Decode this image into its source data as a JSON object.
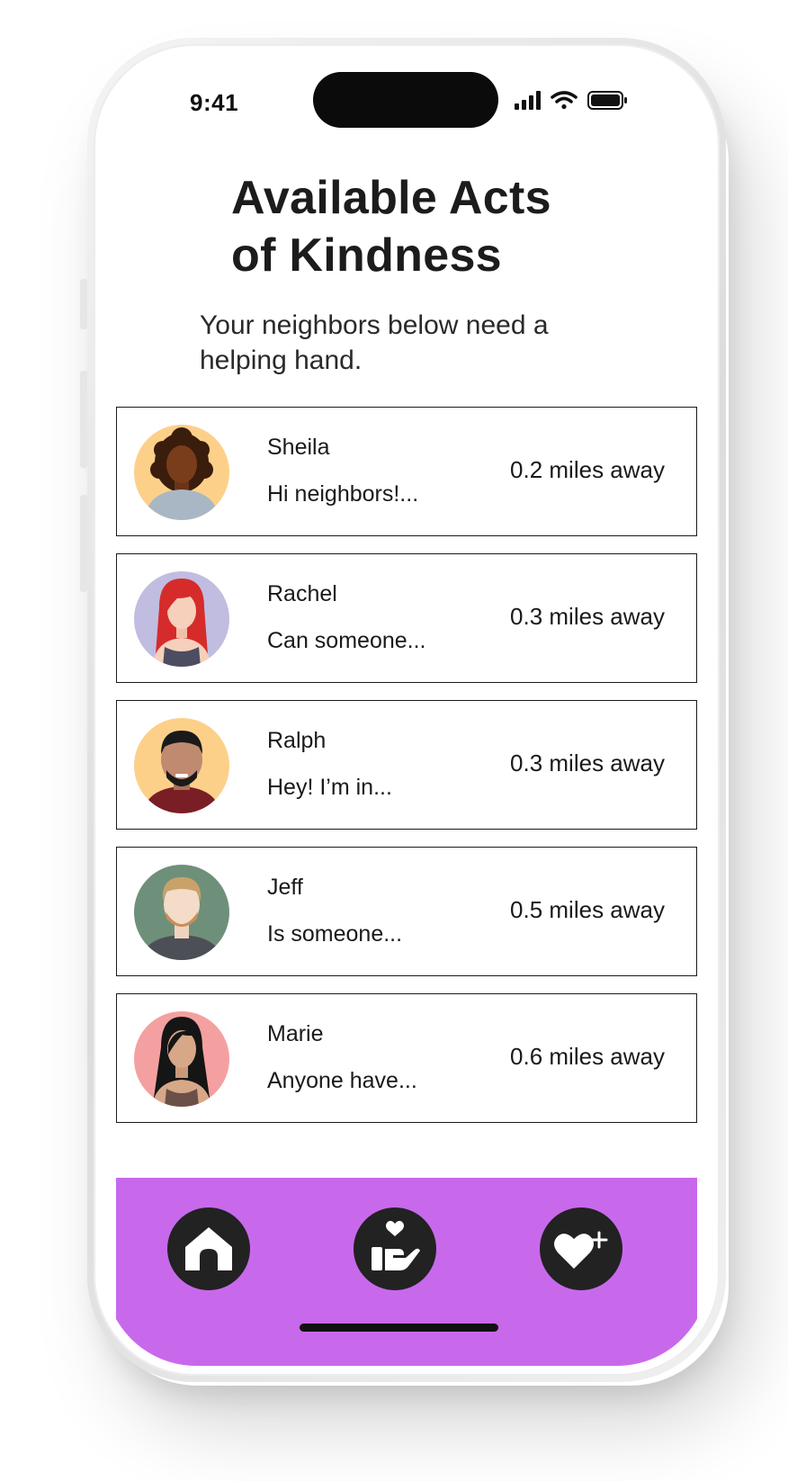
{
  "status_bar": {
    "time": "9:41",
    "icons": [
      "signal-icon",
      "wifi-icon",
      "battery-icon"
    ]
  },
  "header": {
    "title": "Available Acts of Kindness",
    "subtitle": "Your neighbors below need a helping hand."
  },
  "requests": [
    {
      "name": "Sheila",
      "message": "Hi neighbors!...",
      "distance": "0.2 miles away",
      "avatar_bg": "#fdd08a"
    },
    {
      "name": "Rachel",
      "message": "Can someone...",
      "distance": "0.3 miles away",
      "avatar_bg": "#c0bde0"
    },
    {
      "name": "Ralph",
      "message": "Hey! I’m in...",
      "distance": "0.3 miles away",
      "avatar_bg": "#fdd08a"
    },
    {
      "name": "Jeff",
      "message": "Is someone...",
      "distance": "0.5 miles away",
      "avatar_bg": "#6e907a"
    },
    {
      "name": "Marie",
      "message": "Anyone have...",
      "distance": "0.6 miles away",
      "avatar_bg": "#f4a0a0"
    }
  ],
  "nav": {
    "items": [
      {
        "icon": "home-icon"
      },
      {
        "icon": "helping-hand-icon"
      },
      {
        "icon": "heart-plus-icon"
      }
    ]
  },
  "colors": {
    "nav_background": "#c869ec",
    "nav_button": "#222222",
    "card_border": "#1a1a1a",
    "text": "#1a1a1a"
  }
}
